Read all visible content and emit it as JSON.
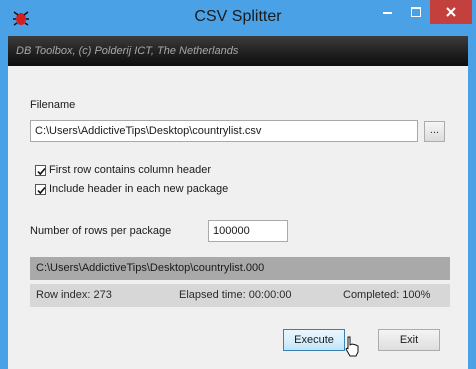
{
  "window": {
    "title": "CSV Splitter",
    "banner": "DB Toolbox, (c) Polderij ICT, The Netherlands"
  },
  "form": {
    "filename_label": "Filename",
    "filename_value": "C:\\Users\\AddictiveTips\\Desktop\\countrylist.csv",
    "browse_label": "...",
    "checkbox_header": {
      "label": "First row contains column header",
      "checked": true
    },
    "checkbox_include": {
      "label": "Include header in each new package",
      "checked": true
    },
    "rows_label": "Number of rows per package",
    "rows_value": "100000"
  },
  "status": {
    "current_file": "C:\\Users\\AddictiveTips\\Desktop\\countrylist.000",
    "row_index": "Row index:  273",
    "elapsed": "Elapsed time:  00:00:00",
    "completed": "Completed:  100%"
  },
  "buttons": {
    "execute": "Execute",
    "exit": "Exit"
  },
  "icons": {
    "app": "bug-icon",
    "minimize": "minimize-icon",
    "maximize": "maximize-icon",
    "close": "close-icon",
    "cursor": "mouse-pointer-icon"
  },
  "colors": {
    "titlebar": "#4aa1e6",
    "close": "#c4403c",
    "banner": "#1e1e1e"
  }
}
